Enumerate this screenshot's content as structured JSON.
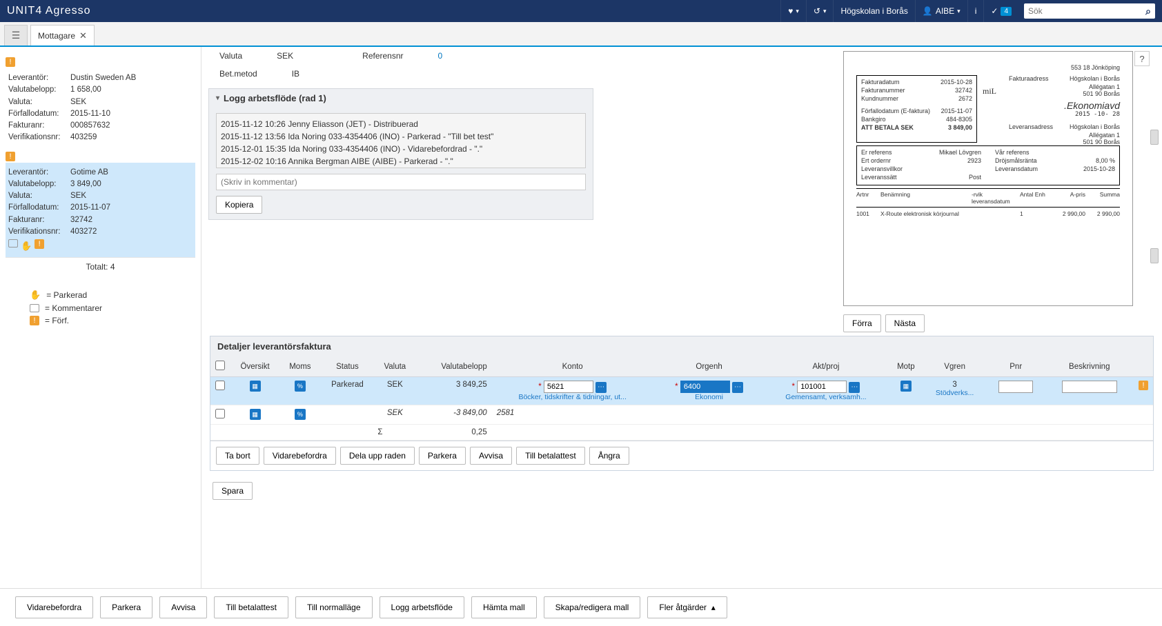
{
  "topbar": {
    "logo_main": "UNIT4",
    "logo_sub": " Agresso",
    "org": "Högskolan i Borås",
    "user": "AIBE",
    "check_badge": "4",
    "search_placeholder": "Sök"
  },
  "tabs": {
    "active": "Mottagare"
  },
  "sidebar": {
    "invoices": [
      {
        "leverantor_lbl": "Leverantör:",
        "leverantor": "Dustin Sweden AB",
        "valutabelopp_lbl": "Valutabelopp:",
        "valutabelopp": "1 658,00",
        "valuta_lbl": "Valuta:",
        "valuta": "SEK",
        "forfallodatum_lbl": "Förfallodatum:",
        "forfallodatum": "2015-11-10",
        "fakturanr_lbl": "Fakturanr:",
        "fakturanr": "000857632",
        "verifikationsnr_lbl": "Verifikationsnr:",
        "verifikationsnr": "403259"
      },
      {
        "leverantor_lbl": "Leverantör:",
        "leverantor": "Gotime AB",
        "valutabelopp_lbl": "Valutabelopp:",
        "valutabelopp": "3 849,00",
        "valuta_lbl": "Valuta:",
        "valuta": "SEK",
        "forfallodatum_lbl": "Förfallodatum:",
        "forfallodatum": "2015-11-07",
        "fakturanr_lbl": "Fakturanr:",
        "fakturanr": "32742",
        "verifikationsnr_lbl": "Verifikationsnr:",
        "verifikationsnr": "403272"
      }
    ],
    "totalt": "Totalt: 4",
    "legend": {
      "parkerad": "= Parkerad",
      "kommentarer": "= Kommentarer",
      "forf": "= Förf."
    }
  },
  "info": {
    "valuta_lbl": "Valuta",
    "valuta": "SEK",
    "betmetod_lbl": "Bet.metod",
    "betmetod": "IB",
    "referensnr_lbl": "Referensnr",
    "referensnr": "0"
  },
  "log": {
    "title": "Logg arbetsflöde (rad 1)",
    "lines": [
      "2015-11-12 10:26 Jenny Eliasson (JET) - Distribuerad",
      "2015-11-12 13:56 Ida Noring 033-4354406 (INO) - Parkerad - \"Till bet test\"",
      "2015-12-01 15:35 Ida Noring 033-4354406 (INO) - Vidarebefordrad - \".\"",
      "2015-12-02 10:16 Annika Bergman AIBE (AIBE) - Parkerad - \".\""
    ],
    "comment_placeholder": "(Skriv in kommentar)",
    "kopiera": "Kopiera"
  },
  "docnav": {
    "forra": "Förra",
    "nasta": "Nästa"
  },
  "doc": {
    "header_right": ".Ekonomiavd",
    "date_stamp": "2015 -10- 28",
    "mil": "miL",
    "f1_l": "Fakturadatum",
    "f1_r": "2015-10-28",
    "f2_l": "Fakturanummer",
    "f2_r": "32742",
    "f3_l": "Kundnummer",
    "f3_r": "2672",
    "f4_l": "Fakturaadress",
    "f4_r": "Högskolan i Borås",
    "f4_r2": "Allégatan 1",
    "f4_r3": "501 90  Borås",
    "f5_l": "Förfallodatum (E-faktura)",
    "f5_r": "2015-11-07",
    "f6_l": "Bankgiro",
    "f6_r": "484-8305",
    "f7_l": "ATT BETALA SEK",
    "f7_r": "3 849,00",
    "f8_l": "Leveransadress",
    "f8_r": "Högskolan i Borås",
    "f8_r2": "Allégatan 1",
    "f8_r3": "501 90  Borås",
    "addr": "553 18  Jönköping",
    "g1_l": "Er referens",
    "g1_r": "Mikael Lövgren",
    "g2_l": "Ert ordernr",
    "g2_r": "2923",
    "g3_l": "Leveransvillkor",
    "g4_l": "Leveranssätt",
    "g4_r": "Post",
    "g5_l": "Vår referens",
    "g6_l": "Dröjsmålsränta",
    "g6_r": "8,00 %",
    "g7_l": "Leveransdatum",
    "g7_r": "2015-10-28",
    "col1": "Artnr",
    "col2": "Benämning",
    "col3": "-rvik leveransdatum",
    "col4": "Antal  Enh",
    "col5": "A-pris",
    "col6": "Summa",
    "r1c1": "1001",
    "r1c2": "X-Route elektronisk körjournal",
    "r1c4": "1",
    "r1c5": "2 990,00",
    "r1c6": "2 990,00"
  },
  "details": {
    "title": "Detaljer leverantörsfaktura",
    "cols": {
      "oversikt": "Översikt",
      "moms": "Moms",
      "status": "Status",
      "valuta": "Valuta",
      "valutabelopp": "Valutabelopp",
      "konto": "Konto",
      "orgenh": "Orgenh",
      "aktproj": "Akt/proj",
      "motp": "Motp",
      "vgren": "Vgren",
      "pnr": "Pnr",
      "beskrivning": "Beskrivning"
    },
    "row1": {
      "status": "Parkerad",
      "valuta": "SEK",
      "belopp": "3 849,25",
      "konto": "5621",
      "konto_desc": "Böcker, tidskrifter & tidningar, ut...",
      "orgenh": "6400",
      "orgenh_desc": "Ekonomi",
      "aktproj": "101001",
      "aktproj_desc": "Gemensamt, verksamh...",
      "vgren": "3",
      "vgren_desc": "Stödverks..."
    },
    "row2": {
      "valuta": "SEK",
      "belopp": "-3 849,00",
      "konto": "2581"
    },
    "sum_sym": "Σ",
    "sum_val": "0,25",
    "actions": {
      "tabort": "Ta bort",
      "vidarebefordra": "Vidarebefordra",
      "delaupp": "Dela upp raden",
      "parkera": "Parkera",
      "avvisa": "Avvisa",
      "tillbetalattest": "Till betalattest",
      "angra": "Ångra"
    }
  },
  "save": "Spara",
  "bottom": {
    "vidarebefordra": "Vidarebefordra",
    "parkera": "Parkera",
    "avvisa": "Avvisa",
    "tillbetalattest": "Till betalattest",
    "tillnormallage": "Till normalläge",
    "loggarbetsflode": "Logg arbetsflöde",
    "hamtamall": "Hämta mall",
    "skaparedigera": "Skapa/redigera mall",
    "fleratgarder": "Fler åtgärder"
  }
}
